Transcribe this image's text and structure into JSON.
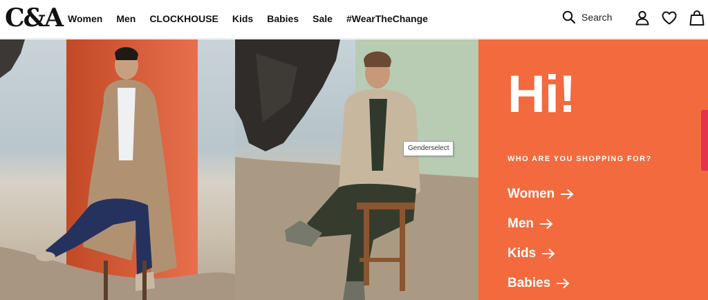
{
  "brand": {
    "logo_text": "C&A"
  },
  "nav": {
    "items": [
      {
        "label": "Women"
      },
      {
        "label": "Men"
      },
      {
        "label": "CLOCKHOUSE"
      },
      {
        "label": "Kids"
      },
      {
        "label": "Babies"
      },
      {
        "label": "Sale"
      },
      {
        "label": "#WearTheChange"
      }
    ]
  },
  "header_actions": {
    "search_label": "Search",
    "account_icon": "user-icon",
    "wishlist_icon": "heart-icon",
    "cart_icon": "shopping-bag-icon"
  },
  "hero": {
    "greeting": "Hi!",
    "subtitle": "WHO ARE YOU SHOPPING FOR?",
    "options": [
      {
        "label": "Women"
      },
      {
        "label": "Men"
      },
      {
        "label": "Kids"
      },
      {
        "label": "Babies"
      }
    ],
    "tooltip": "Genderselect",
    "accent_color": "#f26a3e"
  }
}
